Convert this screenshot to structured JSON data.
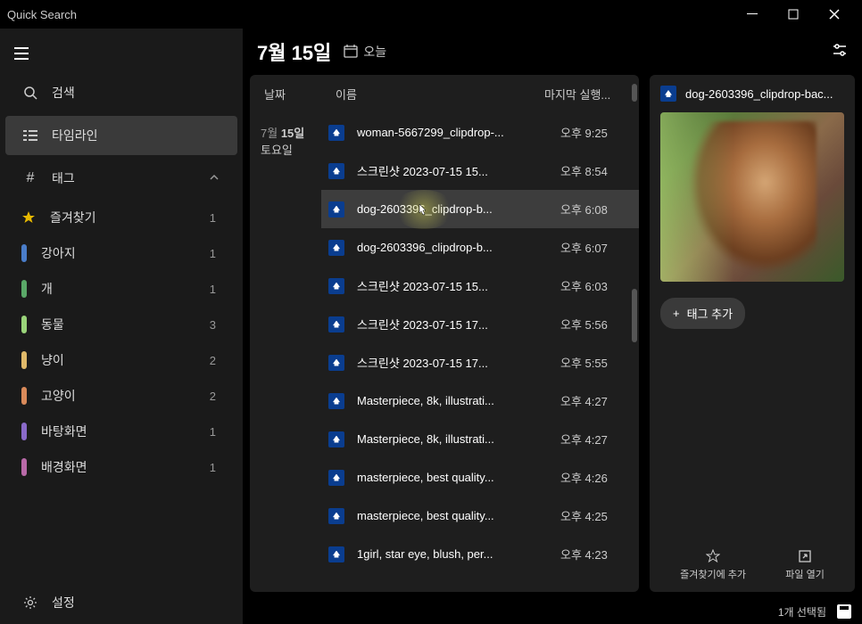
{
  "titlebar": {
    "title": "Quick Search"
  },
  "sidebar": {
    "search": "검색",
    "timeline": "타임라인",
    "tag_header": "태그",
    "settings": "설정",
    "tags": [
      {
        "label": "즐겨찾기",
        "count": "1",
        "color": "star"
      },
      {
        "label": "강아지",
        "count": "1",
        "color": "#4a7dc9"
      },
      {
        "label": "개",
        "count": "1",
        "color": "#5aa868"
      },
      {
        "label": "동물",
        "count": "3",
        "color": "#9ad47a"
      },
      {
        "label": "냥이",
        "count": "2",
        "color": "#e0b96a"
      },
      {
        "label": "고양이",
        "count": "2",
        "color": "#d98a5a"
      },
      {
        "label": "바탕화면",
        "count": "1",
        "color": "#8a6ac9"
      },
      {
        "label": "배경화면",
        "count": "1",
        "color": "#b96aa8"
      }
    ]
  },
  "header": {
    "date": "7월 15일",
    "today": "오늘"
  },
  "list": {
    "col_date": "날짜",
    "col_name": "이름",
    "col_time": "마지막 실행...",
    "date_line1": "7월 15일",
    "date_line2": "토요일",
    "files": [
      {
        "name": "woman-5667299_clipdrop-...",
        "time": "오후 9:25"
      },
      {
        "name": "스크린샷 2023-07-15 15...",
        "time": "오후 8:54"
      },
      {
        "name": "dog-2603396_clipdrop-b...",
        "time": "오후 6:08",
        "selected": true
      },
      {
        "name": "dog-2603396_clipdrop-b...",
        "time": "오후 6:07"
      },
      {
        "name": "스크린샷 2023-07-15 15...",
        "time": "오후 6:03"
      },
      {
        "name": "스크린샷 2023-07-15 17...",
        "time": "오후 5:56"
      },
      {
        "name": "스크린샷 2023-07-15 17...",
        "time": "오후 5:55"
      },
      {
        "name": "Masterpiece, 8k, illustrati...",
        "time": "오후 4:27"
      },
      {
        "name": "Masterpiece, 8k, illustrati...",
        "time": "오후 4:27"
      },
      {
        "name": "masterpiece, best quality...",
        "time": "오후 4:26"
      },
      {
        "name": "masterpiece, best quality...",
        "time": "오후 4:25"
      },
      {
        "name": "1girl, star eye, blush, per...",
        "time": "오후 4:23"
      }
    ]
  },
  "preview": {
    "title": "dog-2603396_clipdrop-bac...",
    "add_tag": "태그 추가",
    "fav_label": "즐겨찾기에 추가",
    "open_label": "파일 열기"
  },
  "statusbar": {
    "selection": "1개 선택됨"
  }
}
